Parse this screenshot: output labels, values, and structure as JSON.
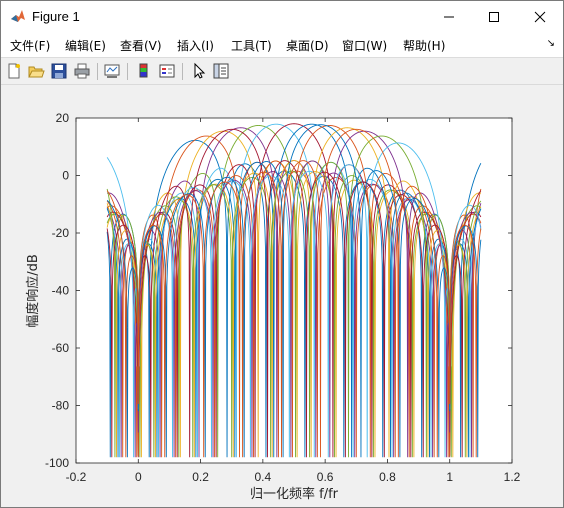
{
  "window": {
    "title": "Figure 1"
  },
  "menu": {
    "items": [
      "文件(F)",
      "编辑(E)",
      "查看(V)",
      "插入(I)",
      "工具(T)",
      "桌面(D)",
      "窗口(W)",
      "帮助(H)"
    ],
    "overflow_icon": "menu-overflow-arrow"
  },
  "toolbar": {
    "buttons": [
      "new-figure-icon",
      "open-file-icon",
      "save-icon",
      "print-icon",
      "link-plot-icon",
      "insert-colorbar-icon",
      "insert-legend-icon",
      "pointer-icon",
      "property-inspector-icon"
    ]
  },
  "chart_data": {
    "type": "line",
    "xlabel": "归一化频率 f/fr",
    "ylabel": "幅度响应/dB",
    "xlim": [
      -0.2,
      1.2
    ],
    "ylim": [
      -100,
      20
    ],
    "xticks": [
      -0.2,
      0,
      0.2,
      0.4,
      0.6,
      0.8,
      1,
      1.2
    ],
    "yticks": [
      -100,
      -80,
      -60,
      -40,
      -20,
      0,
      20
    ],
    "grid": false,
    "legend": "none",
    "x_range_plotted": [
      -0.1,
      1.1
    ],
    "series_model": "beam-steered array factor, 8 elements, main lobe peak ≈ 18 dB, nulls near f/fr = 0 and 1",
    "series": [
      {
        "peak_x": 0.16,
        "peak_db": 18,
        "color": "#0072bd"
      },
      {
        "peak_x": 0.2,
        "peak_db": 18,
        "color": "#d95319"
      },
      {
        "peak_x": 0.26,
        "peak_db": 18,
        "color": "#edb120"
      },
      {
        "peak_x": 0.32,
        "peak_db": 18,
        "color": "#7e2f8e"
      },
      {
        "peak_x": 0.38,
        "peak_db": 18,
        "color": "#77ac30"
      },
      {
        "peak_x": 0.44,
        "peak_db": 18,
        "color": "#4dbeee"
      },
      {
        "peak_x": 0.5,
        "peak_db": 18,
        "color": "#a2142f"
      },
      {
        "peak_x": 0.56,
        "peak_db": 18,
        "color": "#0072bd"
      },
      {
        "peak_x": 0.62,
        "peak_db": 18,
        "color": "#d95319"
      },
      {
        "peak_x": 0.68,
        "peak_db": 18,
        "color": "#edb120"
      },
      {
        "peak_x": 0.74,
        "peak_db": 18,
        "color": "#7e2f8e"
      },
      {
        "peak_x": 0.8,
        "peak_db": 18,
        "color": "#77ac30"
      },
      {
        "peak_x": 0.86,
        "peak_db": 18,
        "color": "#4dbeee"
      },
      {
        "peak_x": 0.29,
        "peak_db": 18,
        "color": "#a2142f"
      },
      {
        "peak_x": 0.59,
        "peak_db": 18,
        "color": "#0072bd"
      },
      {
        "peak_x": 0.71,
        "peak_db": 18,
        "color": "#d95319"
      }
    ]
  }
}
